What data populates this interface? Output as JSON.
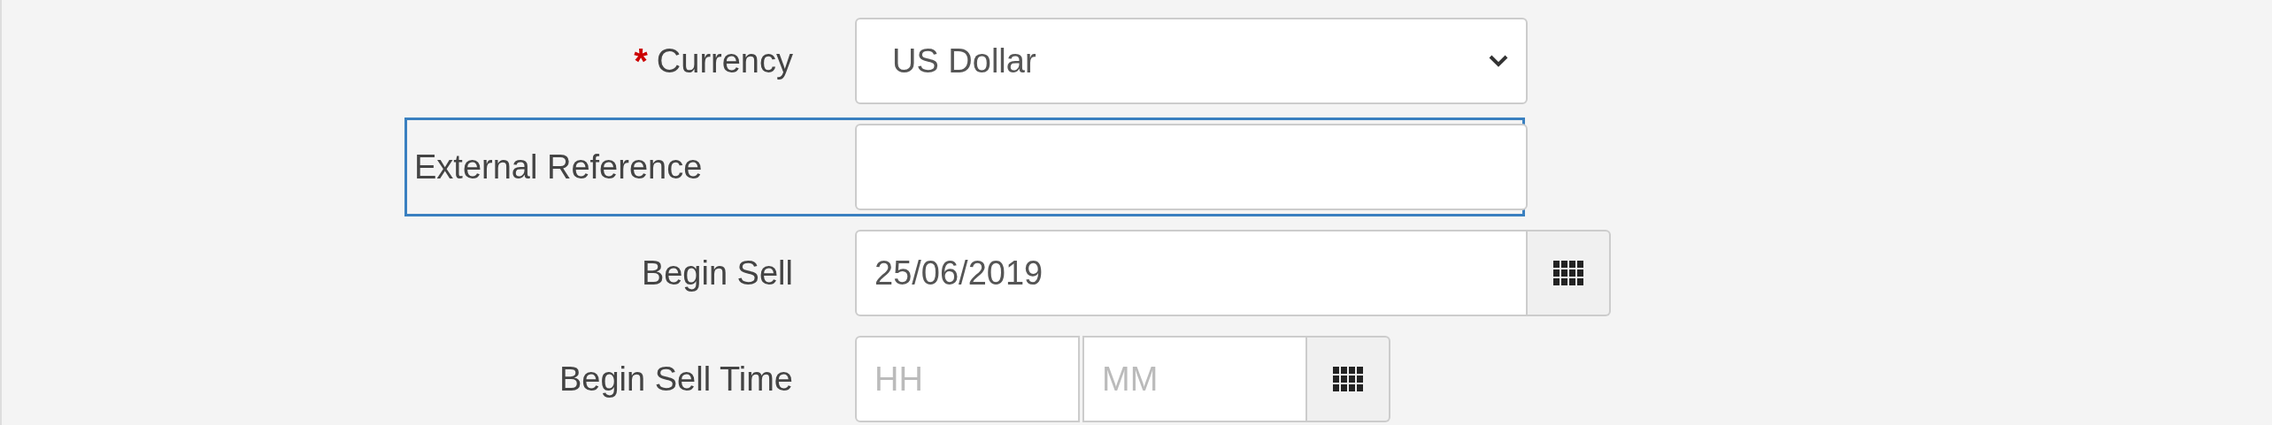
{
  "fields": [
    {
      "kind": "select",
      "label": "Currency",
      "required_marker": "*",
      "focused": false,
      "value": "US Dollar"
    },
    {
      "kind": "text",
      "label": "External Reference",
      "focused": true
    },
    {
      "kind": "date",
      "label": "Begin Sell",
      "focused": false,
      "value": "25/06/2019"
    },
    {
      "kind": "time",
      "label": "Begin Sell Time",
      "focused": false,
      "hour_placeholder": "HH",
      "minute_placeholder": "MM"
    }
  ]
}
